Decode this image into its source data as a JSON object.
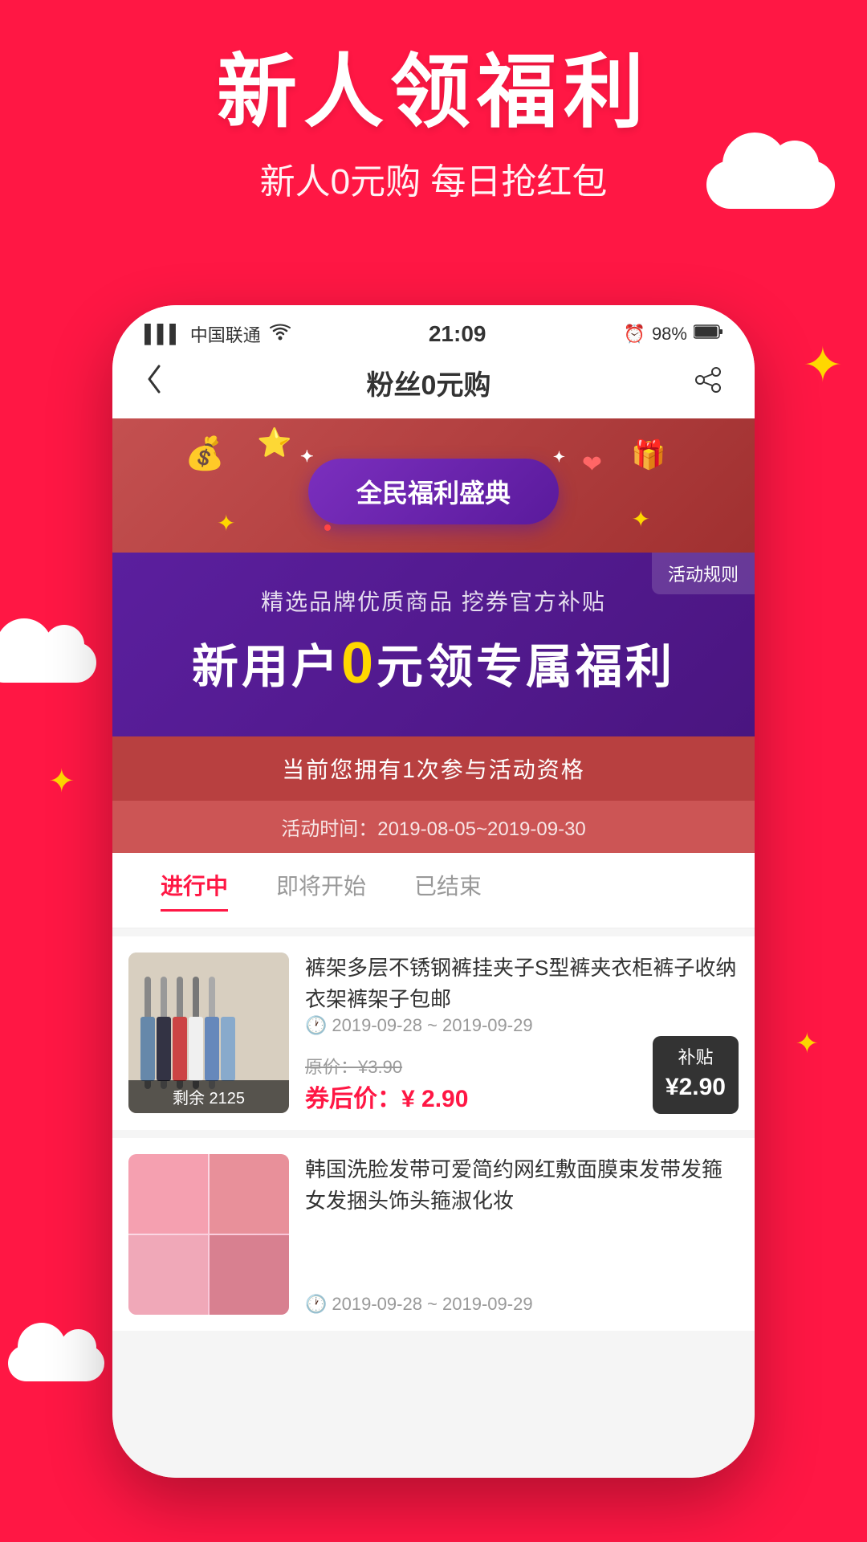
{
  "background": {
    "color": "#FF1744"
  },
  "hero": {
    "title": "新人领福利",
    "subtitle": "新人0元购 每日抢红包"
  },
  "statusBar": {
    "carrier": "中国联通",
    "wifi": true,
    "time": "21:09",
    "battery": "98%"
  },
  "navBar": {
    "title": "粉丝0元购",
    "backLabel": "‹",
    "shareIcon": "share"
  },
  "eventBadge": {
    "text": "全民福利盛典",
    "rulesLabel": "活动规则"
  },
  "promoBanner": {
    "subtitle": "精选品牌优质商品 挖券官方补贴",
    "mainText": "新用户",
    "zero": "0",
    "suffix": "元领专属福利"
  },
  "qualification": {
    "text": "当前您拥有1次参与活动资格"
  },
  "activityDate": {
    "label": "活动时间：",
    "range": "2019-08-05~2019-09-30"
  },
  "tabs": [
    {
      "label": "进行中",
      "active": true
    },
    {
      "label": "即将开始",
      "active": false
    },
    {
      "label": "已结束",
      "active": false
    }
  ],
  "products": [
    {
      "id": 1,
      "title": "裤架多层不锈钢裤挂夹子S型裤夹衣柜裤子收纳衣架裤架子包邮",
      "dateRange": "2019-09-28 ~ 2019-09-29",
      "originalPrice": "¥3.90",
      "discountedPrice": "¥ 2.90",
      "discountedPriceLabel": "券后价：¥ 2.90",
      "remaining": "剩余 2125",
      "subsidyLabel": "补贴",
      "subsidyAmount": "¥2.90",
      "imageType": "hangers"
    },
    {
      "id": 2,
      "title": "韩国洗脸发带可爱简约网红敷面膜束发带发箍女发捆头饰头箍淑化妆",
      "dateRange": "2019-09-28 ~ 2019-09-29",
      "originalPrice": "",
      "discountedPrice": "",
      "discountedPriceLabel": "",
      "remaining": "",
      "subsidyLabel": "",
      "subsidyAmount": "",
      "imageType": "women"
    }
  ]
}
